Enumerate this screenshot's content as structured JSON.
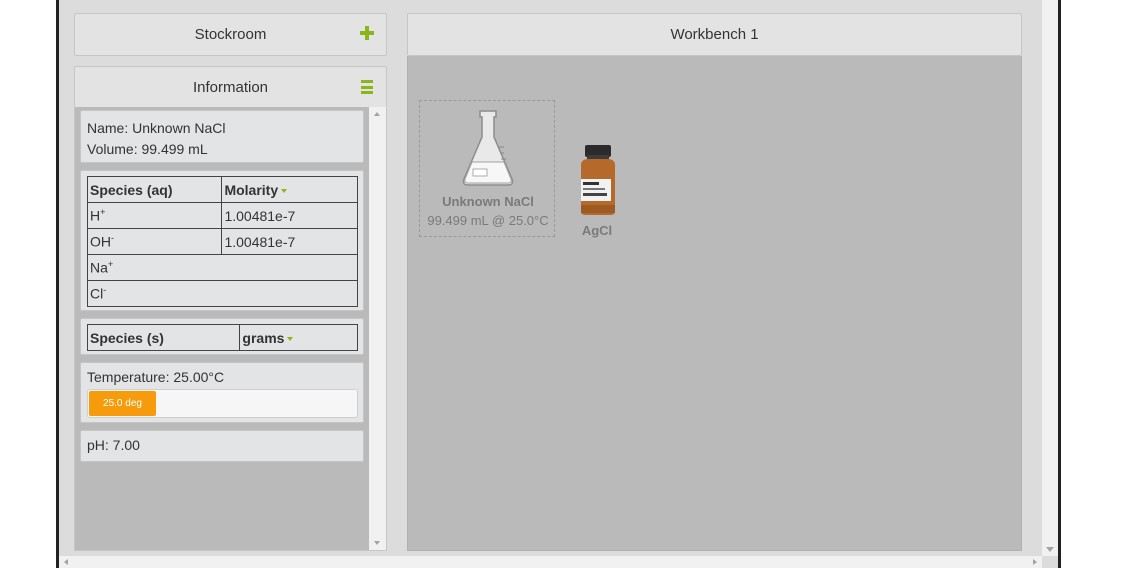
{
  "stockroom": {
    "title": "Stockroom"
  },
  "information": {
    "title": "Information",
    "name_line": "Name: Unknown NaCl",
    "volume_line": "Volume: 99.499 mL",
    "aqueous_table": {
      "headers": [
        "Species (aq)",
        "Molarity"
      ],
      "rows": [
        {
          "base": "H",
          "charge": "+",
          "value": "1.00481e-7"
        },
        {
          "base": "OH",
          "charge": "-",
          "value": "1.00481e-7"
        },
        {
          "base": "Na",
          "charge": "+",
          "value": ""
        },
        {
          "base": "Cl",
          "charge": "-",
          "value": ""
        }
      ]
    },
    "solid_table": {
      "headers": [
        "Species (s)",
        "grams"
      ]
    },
    "temperature_line": "Temperature: 25.00°C",
    "temperature_slider": {
      "label": "25.0 deg",
      "fraction": 0.25
    },
    "ph_line": "pH: 7.00"
  },
  "workbench": {
    "title": "Workbench 1",
    "items": [
      {
        "name": "Unknown NaCl",
        "detail": "99.499 mL @ 25.0°C",
        "icon": "flask-icon"
      },
      {
        "name": "AgCl",
        "icon": "bottle-icon"
      }
    ]
  },
  "colors": {
    "accent": "#8ab61b",
    "slider_fill": "#f59b0c",
    "bench_bg": "#bababa"
  }
}
